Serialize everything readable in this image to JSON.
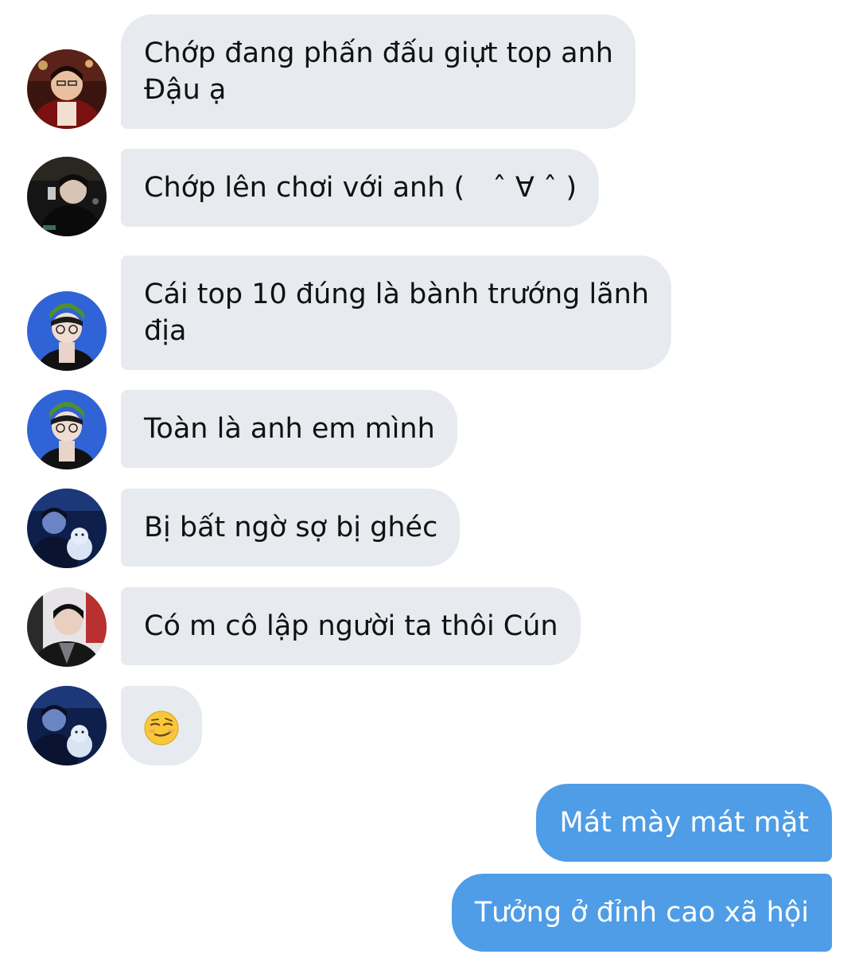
{
  "messages_in": [
    {
      "text": "Chớp đang phấn đấu giựt top anh\nĐậu ạ",
      "avatar": "avatar-red-jacket"
    },
    {
      "text": "Chớp lên chơi với anh (　ˆ ∀ ˆ )",
      "avatar": "avatar-dark-stage"
    },
    {
      "text": "Cái top 10 đúng là bành trướng lãnh\nđịa",
      "avatar": "avatar-blue-green-hat"
    },
    {
      "text": "Toàn là anh em mình",
      "avatar": "avatar-blue-green-hat"
    },
    {
      "text": "Bị bất ngờ sợ bị ghéc",
      "avatar": "avatar-blue-plush"
    },
    {
      "text": "Có m cô lập người ta thôi Cún",
      "avatar": "avatar-suit"
    },
    {
      "text": "",
      "emoji": "smirking-face-emoji",
      "avatar": "avatar-blue-plush"
    }
  ],
  "messages_out": [
    {
      "text": "Mát mày mát mặt"
    },
    {
      "text": "Tưởng ở đỉnh cao xã hội"
    }
  ],
  "colors": {
    "incoming_bubble": "#e7ebef",
    "outgoing_bubble": "#4e9de6"
  }
}
